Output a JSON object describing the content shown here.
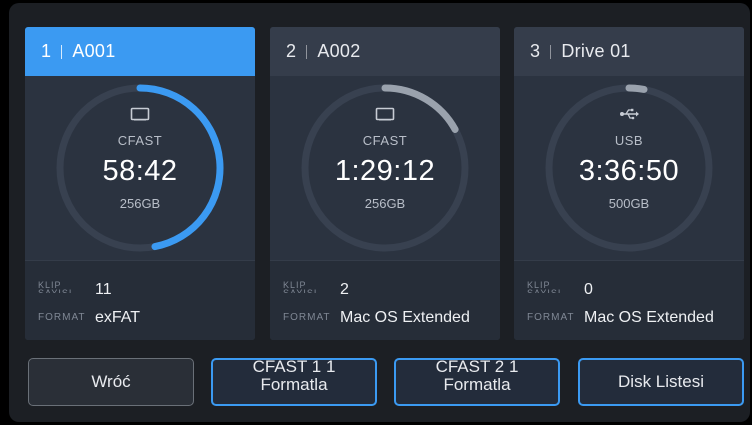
{
  "cards": [
    {
      "slot": "1",
      "name": "A001",
      "media_type": "CFAST",
      "remaining": "58:42",
      "capacity": "256GB",
      "icon": "cfast-card-icon",
      "fill_fraction": 0.47,
      "clips_label": "KLİP SAYISI",
      "clips_value": "11",
      "format_label": "FORMAT",
      "format_value": "exFAT",
      "active": true
    },
    {
      "slot": "2",
      "name": "A002",
      "media_type": "CFAST",
      "remaining": "1:29:12",
      "capacity": "256GB",
      "icon": "cfast-card-icon",
      "fill_fraction": 0.17,
      "clips_label": "KLİP SAYISI",
      "clips_value": "2",
      "format_label": "FORMAT",
      "format_value": "Mac OS Extended",
      "active": false
    },
    {
      "slot": "3",
      "name": "Drive 01",
      "media_type": "USB",
      "remaining": "3:36:50",
      "capacity": "500GB",
      "icon": "usb-icon",
      "fill_fraction": 0.03,
      "clips_label": "KLİP SAYISI",
      "clips_value": "0",
      "format_label": "FORMAT",
      "format_value": "Mac OS Extended",
      "active": false
    }
  ],
  "buttons": {
    "back": "Wróć",
    "format1_line1": "CFAST 1 1",
    "format1_line2": "Formatla",
    "format2_line1": "CFAST 2 1",
    "format2_line2": "Formatla",
    "disk_list": "Disk Listesi"
  },
  "colors": {
    "accent": "#3b9af2",
    "ring_track": "#384150",
    "ring_fill_inactive": "#9aa2ad"
  }
}
